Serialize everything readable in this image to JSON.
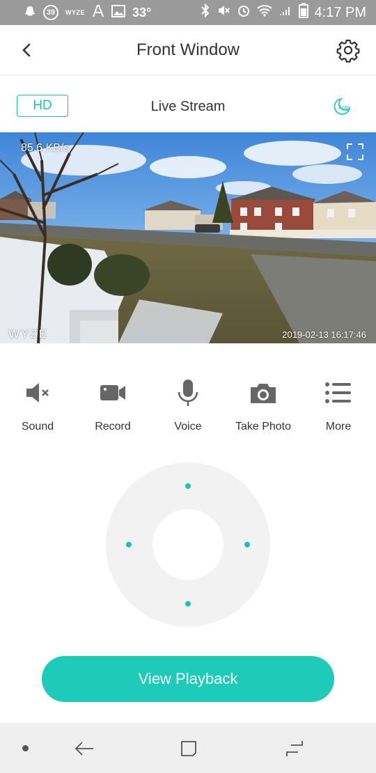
{
  "status_bar": {
    "notification_count": "39",
    "brand_mini": "WYZE",
    "temperature": "33°",
    "battery": "86",
    "time": "4:17 PM"
  },
  "header": {
    "title": "Front Window",
    "back_icon": "chevron-left-icon",
    "settings_icon": "gear-icon"
  },
  "stream_bar": {
    "quality_label": "HD",
    "label": "Live Stream",
    "auto_label": "Auto"
  },
  "camera": {
    "bitrate": "85.6 KB/s",
    "brand_watermark": "WYZE",
    "timestamp": "2019-02-13  16:17:46"
  },
  "controls": [
    {
      "label": "Sound",
      "icon": "speaker-muted-icon"
    },
    {
      "label": "Record",
      "icon": "video-camera-icon"
    },
    {
      "label": "Voice",
      "icon": "microphone-icon"
    },
    {
      "label": "Take Photo",
      "icon": "camera-icon"
    },
    {
      "label": "More",
      "icon": "list-icon"
    }
  ],
  "playback_button": "View Playback",
  "colors": {
    "accent": "#16c4b5",
    "button": "#1ccbb8",
    "status_bar": "#9a9a9a"
  }
}
